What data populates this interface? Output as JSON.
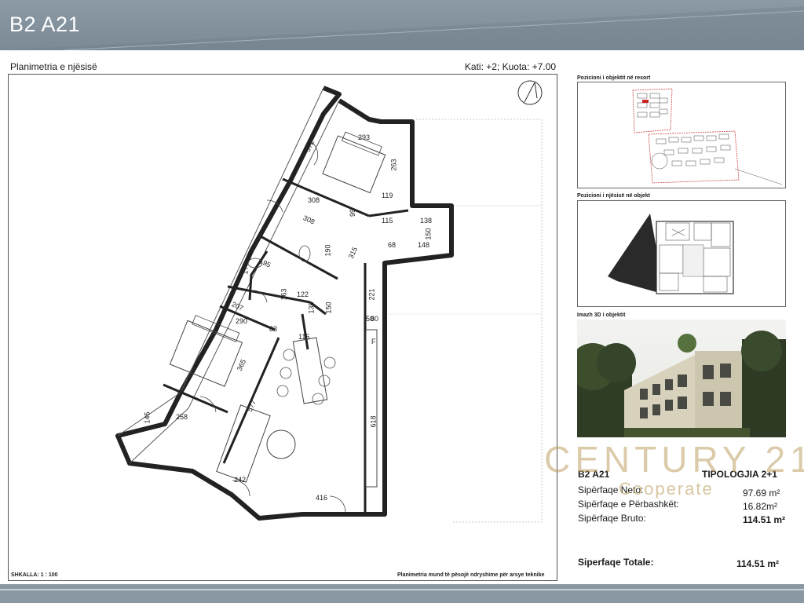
{
  "header": {
    "title": "B2 A21"
  },
  "plan": {
    "title": "Planimetria e njësisë",
    "floor_info": "Kati: +2; Kuota: +7.00",
    "scale": "SHKALLA:     1 : 100",
    "note": "Planimetria mund të pësojë ndryshime për arsye teknike",
    "dimensions": [
      "293",
      "372",
      "263",
      "308",
      "119",
      "308",
      "99",
      "115",
      "138",
      "150",
      "68",
      "148",
      "190",
      "315",
      "195",
      "170",
      "163",
      "122",
      "207",
      "138",
      "150",
      "221",
      "290",
      "83",
      "115",
      "365",
      "258",
      "145",
      "577",
      "618",
      "242",
      "416",
      "50",
      "80",
      "F"
    ]
  },
  "side": {
    "resort_caption": "Pozicioni i objektit në resort",
    "object_caption": "Pozicioni i njësisë në objekt",
    "photo_caption": "Imazh 3D i objektit"
  },
  "unit": {
    "code": "B2 A21",
    "typology": "TIPOLOGJIA 2+1",
    "rows": [
      {
        "label": "Sipërfaqe Neto:",
        "value": "97.69 m²"
      },
      {
        "label": "Sipërfaqe e Përbashkët:",
        "value": "16.82m²"
      },
      {
        "label": "Sipërfaqe Bruto:",
        "value": "114.51 m²"
      }
    ],
    "total_label": "Siperfaqe Totale:",
    "total_value": "114.51 m²"
  },
  "watermark": {
    "main": "CENTURY 21",
    "sub": "Cooperate"
  }
}
